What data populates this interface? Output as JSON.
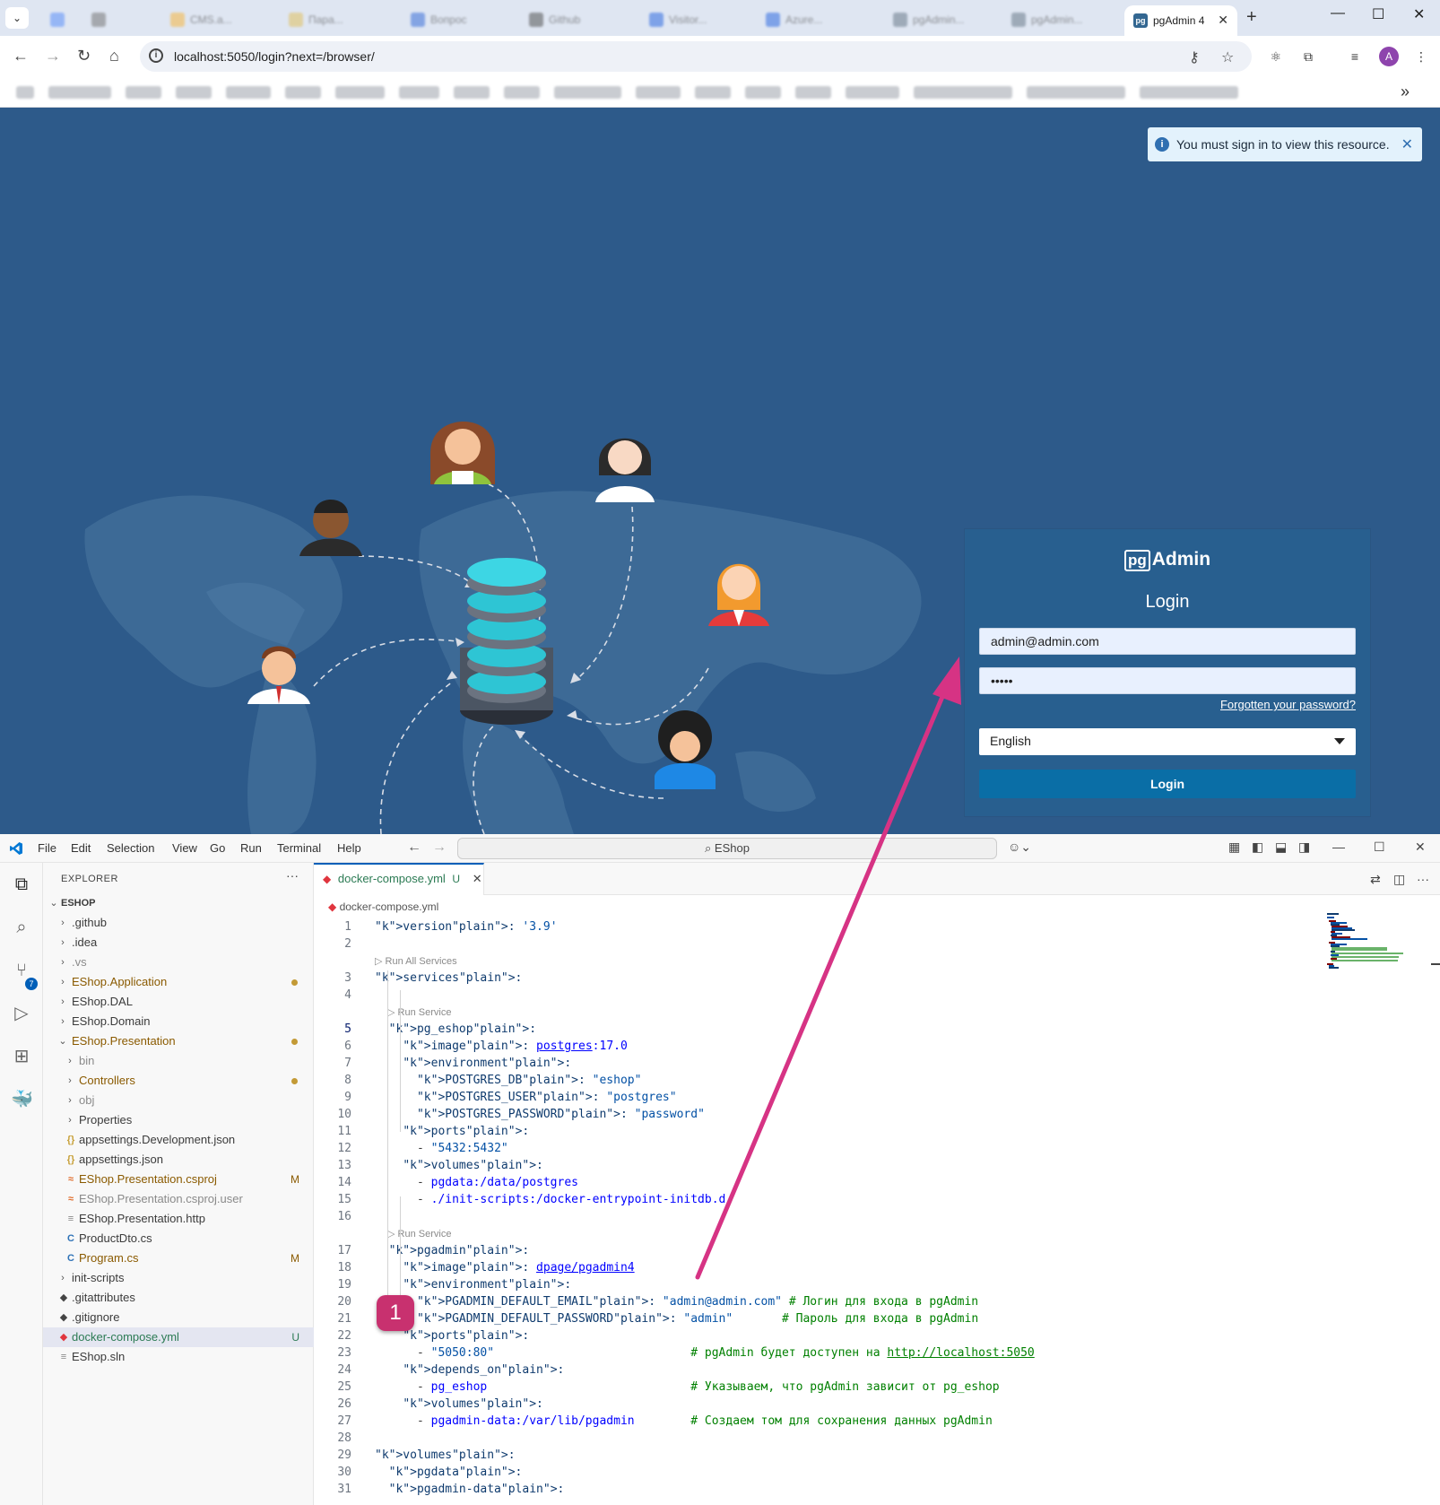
{
  "browser": {
    "active_tab": {
      "title": "pgAdmin 4",
      "favicon": "pg"
    },
    "blurred_tabs": [
      "",
      "",
      "CMS.a...",
      "Пара...",
      "Вопрос",
      "Github",
      "Visitor...",
      "Azure...",
      "pgAdmin...",
      "pgAdmin..."
    ],
    "url": "localhost:5050/login?next=/browser/",
    "bookmarks": [
      "",
      "",
      "",
      "",
      "",
      "",
      "",
      "",
      "",
      "",
      "",
      "",
      "",
      "",
      "",
      "",
      "",
      "",
      ""
    ],
    "avatar_letter": "A"
  },
  "pgadmin": {
    "toast_message": "You must sign in to view this resource.",
    "logo_pg": "pg",
    "logo_admin": "Admin",
    "login_title": "Login",
    "email_value": "admin@admin.com",
    "password_masked": "•••••",
    "forgot_link": "Forgotten your password?",
    "language": "English",
    "login_button": "Login"
  },
  "vscode": {
    "menu": [
      "File",
      "Edit",
      "Selection",
      "View",
      "Go",
      "Run",
      "Terminal",
      "Help"
    ],
    "command_center": "EShop",
    "source_control_badge": "7",
    "explorer": {
      "header": "EXPLORER",
      "root": "ESHOP",
      "items": [
        {
          "label": ".github",
          "type": "folder",
          "depth": 1
        },
        {
          "label": ".idea",
          "type": "folder",
          "depth": 1
        },
        {
          "label": ".vs",
          "type": "folder",
          "depth": 1,
          "muted": true
        },
        {
          "label": "EShop.Application",
          "type": "folder",
          "depth": 1,
          "modified_dot": true,
          "color": "#8a5a00"
        },
        {
          "label": "EShop.DAL",
          "type": "folder",
          "depth": 1
        },
        {
          "label": "EShop.Domain",
          "type": "folder",
          "depth": 1
        },
        {
          "label": "EShop.Presentation",
          "type": "folder-open",
          "depth": 1,
          "modified_dot": true,
          "color": "#8a5a00"
        },
        {
          "label": "bin",
          "type": "folder",
          "depth": 2,
          "muted": true
        },
        {
          "label": "Controllers",
          "type": "folder",
          "depth": 2,
          "modified_dot": true,
          "color": "#8a5a00"
        },
        {
          "label": "obj",
          "type": "folder",
          "depth": 2,
          "muted": true
        },
        {
          "label": "Properties",
          "type": "folder",
          "depth": 2
        },
        {
          "label": "appsettings.Development.json",
          "type": "json",
          "depth": 2
        },
        {
          "label": "appsettings.json",
          "type": "json",
          "depth": 2
        },
        {
          "label": "EShop.Presentation.csproj",
          "type": "rss",
          "depth": 2,
          "mark": "M",
          "color": "#8a5a00"
        },
        {
          "label": "EShop.Presentation.csproj.user",
          "type": "rss",
          "depth": 2,
          "muted": true
        },
        {
          "label": "EShop.Presentation.http",
          "type": "lines",
          "depth": 2
        },
        {
          "label": "ProductDto.cs",
          "type": "cs",
          "depth": 2
        },
        {
          "label": "Program.cs",
          "type": "cs",
          "depth": 2,
          "mark": "M",
          "color": "#8a5a00"
        },
        {
          "label": "init-scripts",
          "type": "folder",
          "depth": 1
        },
        {
          "label": ".gitattributes",
          "type": "git",
          "depth": 1
        },
        {
          "label": ".gitignore",
          "type": "git",
          "depth": 1
        },
        {
          "label": "docker-compose.yml",
          "type": "docker",
          "depth": 1,
          "mark": "U",
          "selected": true,
          "color": "#2c7b54"
        },
        {
          "label": "EShop.sln",
          "type": "lines",
          "depth": 1
        }
      ]
    },
    "editor": {
      "tab_file": "docker-compose.yml",
      "tab_status": "U",
      "breadcrumb": "docker-compose.yml",
      "codelens_all": "Run All Services",
      "codelens_service": "Run Service",
      "lines": [
        "version: '3.9'",
        "",
        "services:",
        "",
        "  pg_eshop:",
        "    image: postgres:17.0",
        "    environment:",
        "      POSTGRES_DB: \"eshop\"",
        "      POSTGRES_USER: \"postgres\"",
        "      POSTGRES_PASSWORD: \"password\"",
        "    ports:",
        "      - \"5432:5432\"",
        "    volumes:",
        "      - pgdata:/data/postgres",
        "      - ./init-scripts:/docker-entrypoint-initdb.d",
        "",
        "  pgadmin:",
        "    image: dpage/pgadmin4",
        "    environment:",
        "      PGADMIN_DEFAULT_EMAIL: \"admin@admin.com\" # Логин для входа в pgAdmin",
        "      PGADMIN_DEFAULT_PASSWORD: \"admin\"       # Пароль для входа в pgAdmin",
        "    ports:",
        "      - \"5050:80\"                            # pgAdmin будет доступен на http://localhost:5050",
        "    depends_on:",
        "      - pg_eshop                             # Указываем, что pgAdmin зависит от pg_eshop",
        "    volumes:",
        "      - pgadmin-data:/var/lib/pgadmin        # Создаем том для сохранения данных pgAdmin",
        "",
        "volumes:",
        "  pgdata:",
        "  pgadmin-data:"
      ]
    }
  },
  "annotation": {
    "step_badge": "1",
    "arrow_color": "#d63384"
  },
  "colors": {
    "pgadmin_bg": "#2d5a8a",
    "login_btn": "#0a6ea6",
    "vscode_accent": "#005fb8"
  }
}
